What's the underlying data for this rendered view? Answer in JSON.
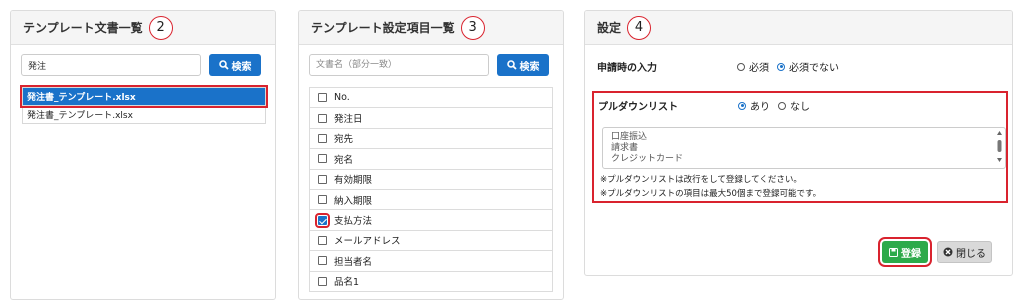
{
  "panel1": {
    "title": "テンプレート文書一覧",
    "number": "2",
    "search_value": "発注",
    "search_button": "検索",
    "items": [
      "発注書_テンプレート.xlsx",
      "発注書_テンプレート.xlsx"
    ]
  },
  "panel2": {
    "title": "テンプレート設定項目一覧",
    "number": "3",
    "search_placeholder": "文書名（部分一致）",
    "search_button": "検索",
    "items": [
      "No.",
      "発注日",
      "宛先",
      "宛名",
      "有効期限",
      "納入期限",
      "支払方法",
      "メールアドレス",
      "担当者名",
      "品名1"
    ]
  },
  "panel3": {
    "title": "設定",
    "number": "4",
    "input_label": "申請時の入力",
    "input_required": "必須",
    "input_not_required": "必須でない",
    "pulldown_label": "プルダウンリスト",
    "pulldown_yes": "あり",
    "pulldown_no": "なし",
    "options": [
      "口座振込",
      "請求書",
      "クレジットカード"
    ],
    "note1": "※プルダウンリストは改行をして登録してください。",
    "note2": "※プルダウンリストの項目は最大50個まで登録可能です。",
    "register_button": "登録",
    "close_button": "閉じる"
  },
  "colors": {
    "primary": "#1a72c9",
    "success": "#2daa4a",
    "highlight": "#d9232e"
  }
}
